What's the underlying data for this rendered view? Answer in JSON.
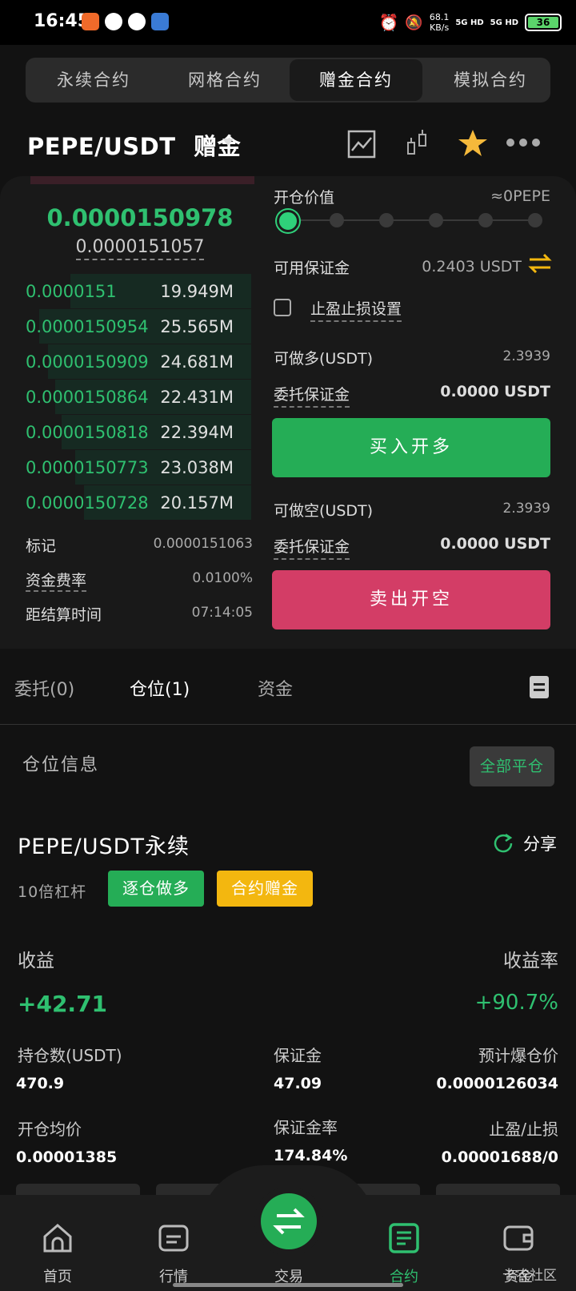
{
  "status_bar": {
    "time": "16:45",
    "net_speed_value": "68.1",
    "net_speed_unit": "KB/s",
    "signal1": "5G HD",
    "signal2": "5G HD",
    "battery": "36"
  },
  "top_tabs": [
    {
      "label": "永续合约"
    },
    {
      "label": "网格合约"
    },
    {
      "label": "赠金合约"
    },
    {
      "label": "模拟合约"
    }
  ],
  "pair": {
    "title": "PEPE/USDT",
    "badge": "赠金"
  },
  "orderbook": {
    "last_price": "0.0000150978",
    "mark_price": "0.0000151057",
    "bids": [
      {
        "price": "0.0000151",
        "size": "19.949M",
        "depth": 0.8
      },
      {
        "price": "0.0000150954",
        "size": "25.565M",
        "depth": 0.94
      },
      {
        "price": "0.0000150909",
        "size": "24.681M",
        "depth": 0.9
      },
      {
        "price": "0.0000150864",
        "size": "22.431M",
        "depth": 0.87
      },
      {
        "price": "0.0000150818",
        "size": "22.394M",
        "depth": 0.84
      },
      {
        "price": "0.0000150773",
        "size": "23.038M",
        "depth": 0.78
      },
      {
        "price": "0.0000150728",
        "size": "20.157M",
        "depth": 0.74
      }
    ]
  },
  "market_info": {
    "mark_label": "标记",
    "mark_value": "0.0000151063",
    "funding_label": "资金费率",
    "funding_value": "0.0100%",
    "settle_label": "距结算时间",
    "settle_value": "07:14:05"
  },
  "form": {
    "open_value_label": "开仓价值",
    "open_value": "≈0PEPE",
    "available_label": "可用保证金",
    "available_value": "0.2403 USDT",
    "tpsl_label": "止盈止损设置",
    "long_max_label": "可做多(USDT)",
    "long_max_value": "2.3939",
    "long_margin_label": "委托保证金",
    "long_margin_value": "0.0000 USDT",
    "buy_button": "买入开多",
    "short_max_label": "可做空(USDT)",
    "short_max_value": "2.3939",
    "short_margin_label": "委托保证金",
    "short_margin_value": "0.0000 USDT",
    "sell_button": "卖出开空"
  },
  "lower_tabs": [
    {
      "label": "委托(0)"
    },
    {
      "label": "仓位(1)"
    },
    {
      "label": "资金"
    }
  ],
  "position": {
    "section_title": "仓位信息",
    "close_all": "全部平仓",
    "title": "PEPE/USDT永续",
    "share": "分享",
    "leverage": "10倍杠杆",
    "tag_mode": "逐仓做多",
    "tag_bonus": "合约赠金",
    "pnl_label": "收益",
    "pnl_value": "+42.71",
    "pnl_rate_label": "收益率",
    "pnl_rate_value": "+90.7%",
    "size_label": "持仓数(USDT)",
    "size_value": "470.9",
    "margin_label": "保证金",
    "margin_value": "47.09",
    "liq_label": "预计爆仓价",
    "liq_value": "0.0000126034",
    "entry_label": "开仓均价",
    "entry_value": "0.00001385",
    "margin_rate_label": "保证金率",
    "margin_rate_value": "174.84%",
    "tpsl_label": "止盈/止损",
    "tpsl_value": "0.00001688/0"
  },
  "bottom_nav": [
    {
      "label": "首页"
    },
    {
      "label": "行情"
    },
    {
      "label": "交易"
    },
    {
      "label": "合约"
    },
    {
      "label": "资金"
    }
  ],
  "watermark": "卡农社区",
  "colors": {
    "green": "#2fc070",
    "red": "#d33d66",
    "yellow": "#f3b70f",
    "star": "#f5b93b",
    "background": "#121212"
  }
}
